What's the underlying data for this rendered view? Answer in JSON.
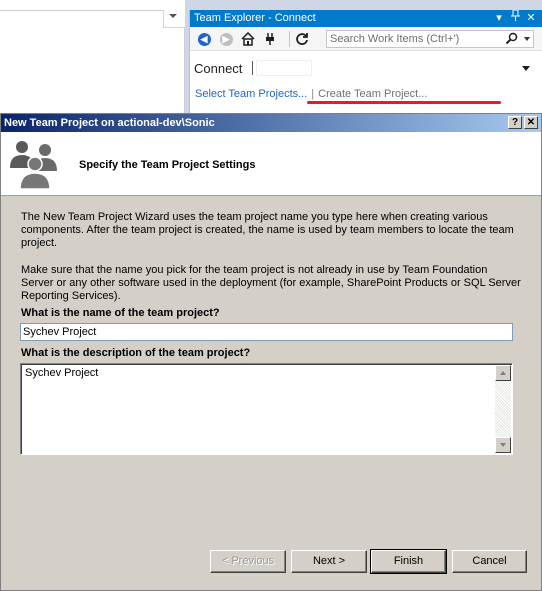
{
  "team_explorer": {
    "title": "Team Explorer - Connect",
    "title_buttons": [
      "▾",
      "✕",
      "⊞",
      "✕"
    ],
    "search_placeholder": "Search Work Items (Ctrl+')",
    "connect_label": "Connect",
    "link_select": "Select Team Projects...",
    "link_separator": "|",
    "link_create": "Create Team Project...",
    "annotation_color": "#e51c23"
  },
  "dialog": {
    "title": "New Team Project on actional-dev\\Sonic",
    "help_button": "?",
    "close_button": "✕",
    "header_title": "Specify the Team Project Settings",
    "intro_text": "The New Team Project Wizard uses the team project name you type here when creating various components. After the team project is created, the name is used by team members to locate the team project.",
    "warning_text": "Make sure that the name you pick for the team project is not already in use by Team Foundation Server or any other software used in the deployment (for example, SharePoint Products or SQL Server Reporting Services).",
    "name_label": "What is the name of the team project?",
    "name_value": "Sychev Project",
    "description_label": "What is the description of the team project?",
    "description_value": "Sychev Project",
    "buttons": {
      "previous": "< Previous",
      "next": "Next >",
      "finish": "Finish",
      "cancel": "Cancel"
    }
  }
}
